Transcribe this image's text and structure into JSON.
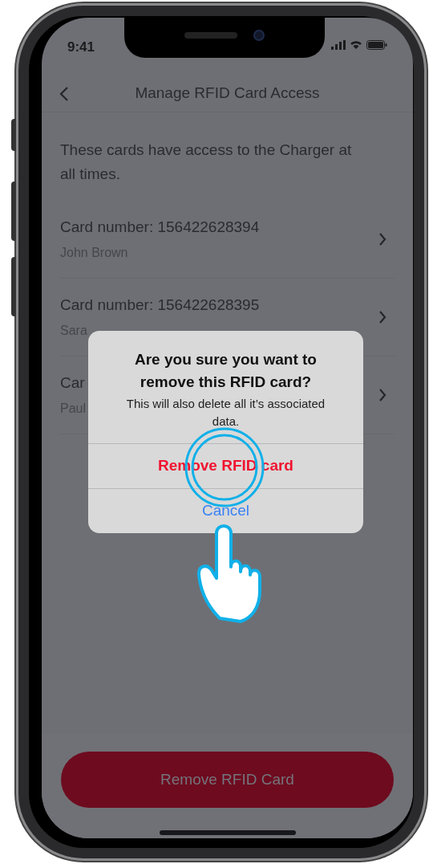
{
  "status_bar": {
    "time": "9:41"
  },
  "header": {
    "title": "Manage RFID Card Access"
  },
  "description": "These cards have access to the Charger at all times.",
  "cards": [
    {
      "number": "Card number: 156422628394",
      "holder": "John Brown"
    },
    {
      "number": "Card number: 156422628395",
      "holder": "Sara"
    },
    {
      "number": "Car",
      "holder": "Paul"
    }
  ],
  "dialog": {
    "title": "Are you sure you want to remove this RFID card?",
    "message": "This will also delete all it’s associated data.",
    "actions": [
      {
        "label": "Remove RFID card",
        "kind": "destructive"
      },
      {
        "label": "Cancel",
        "kind": "cancel"
      }
    ]
  },
  "footer_button": {
    "label": "Remove RFID Card"
  }
}
